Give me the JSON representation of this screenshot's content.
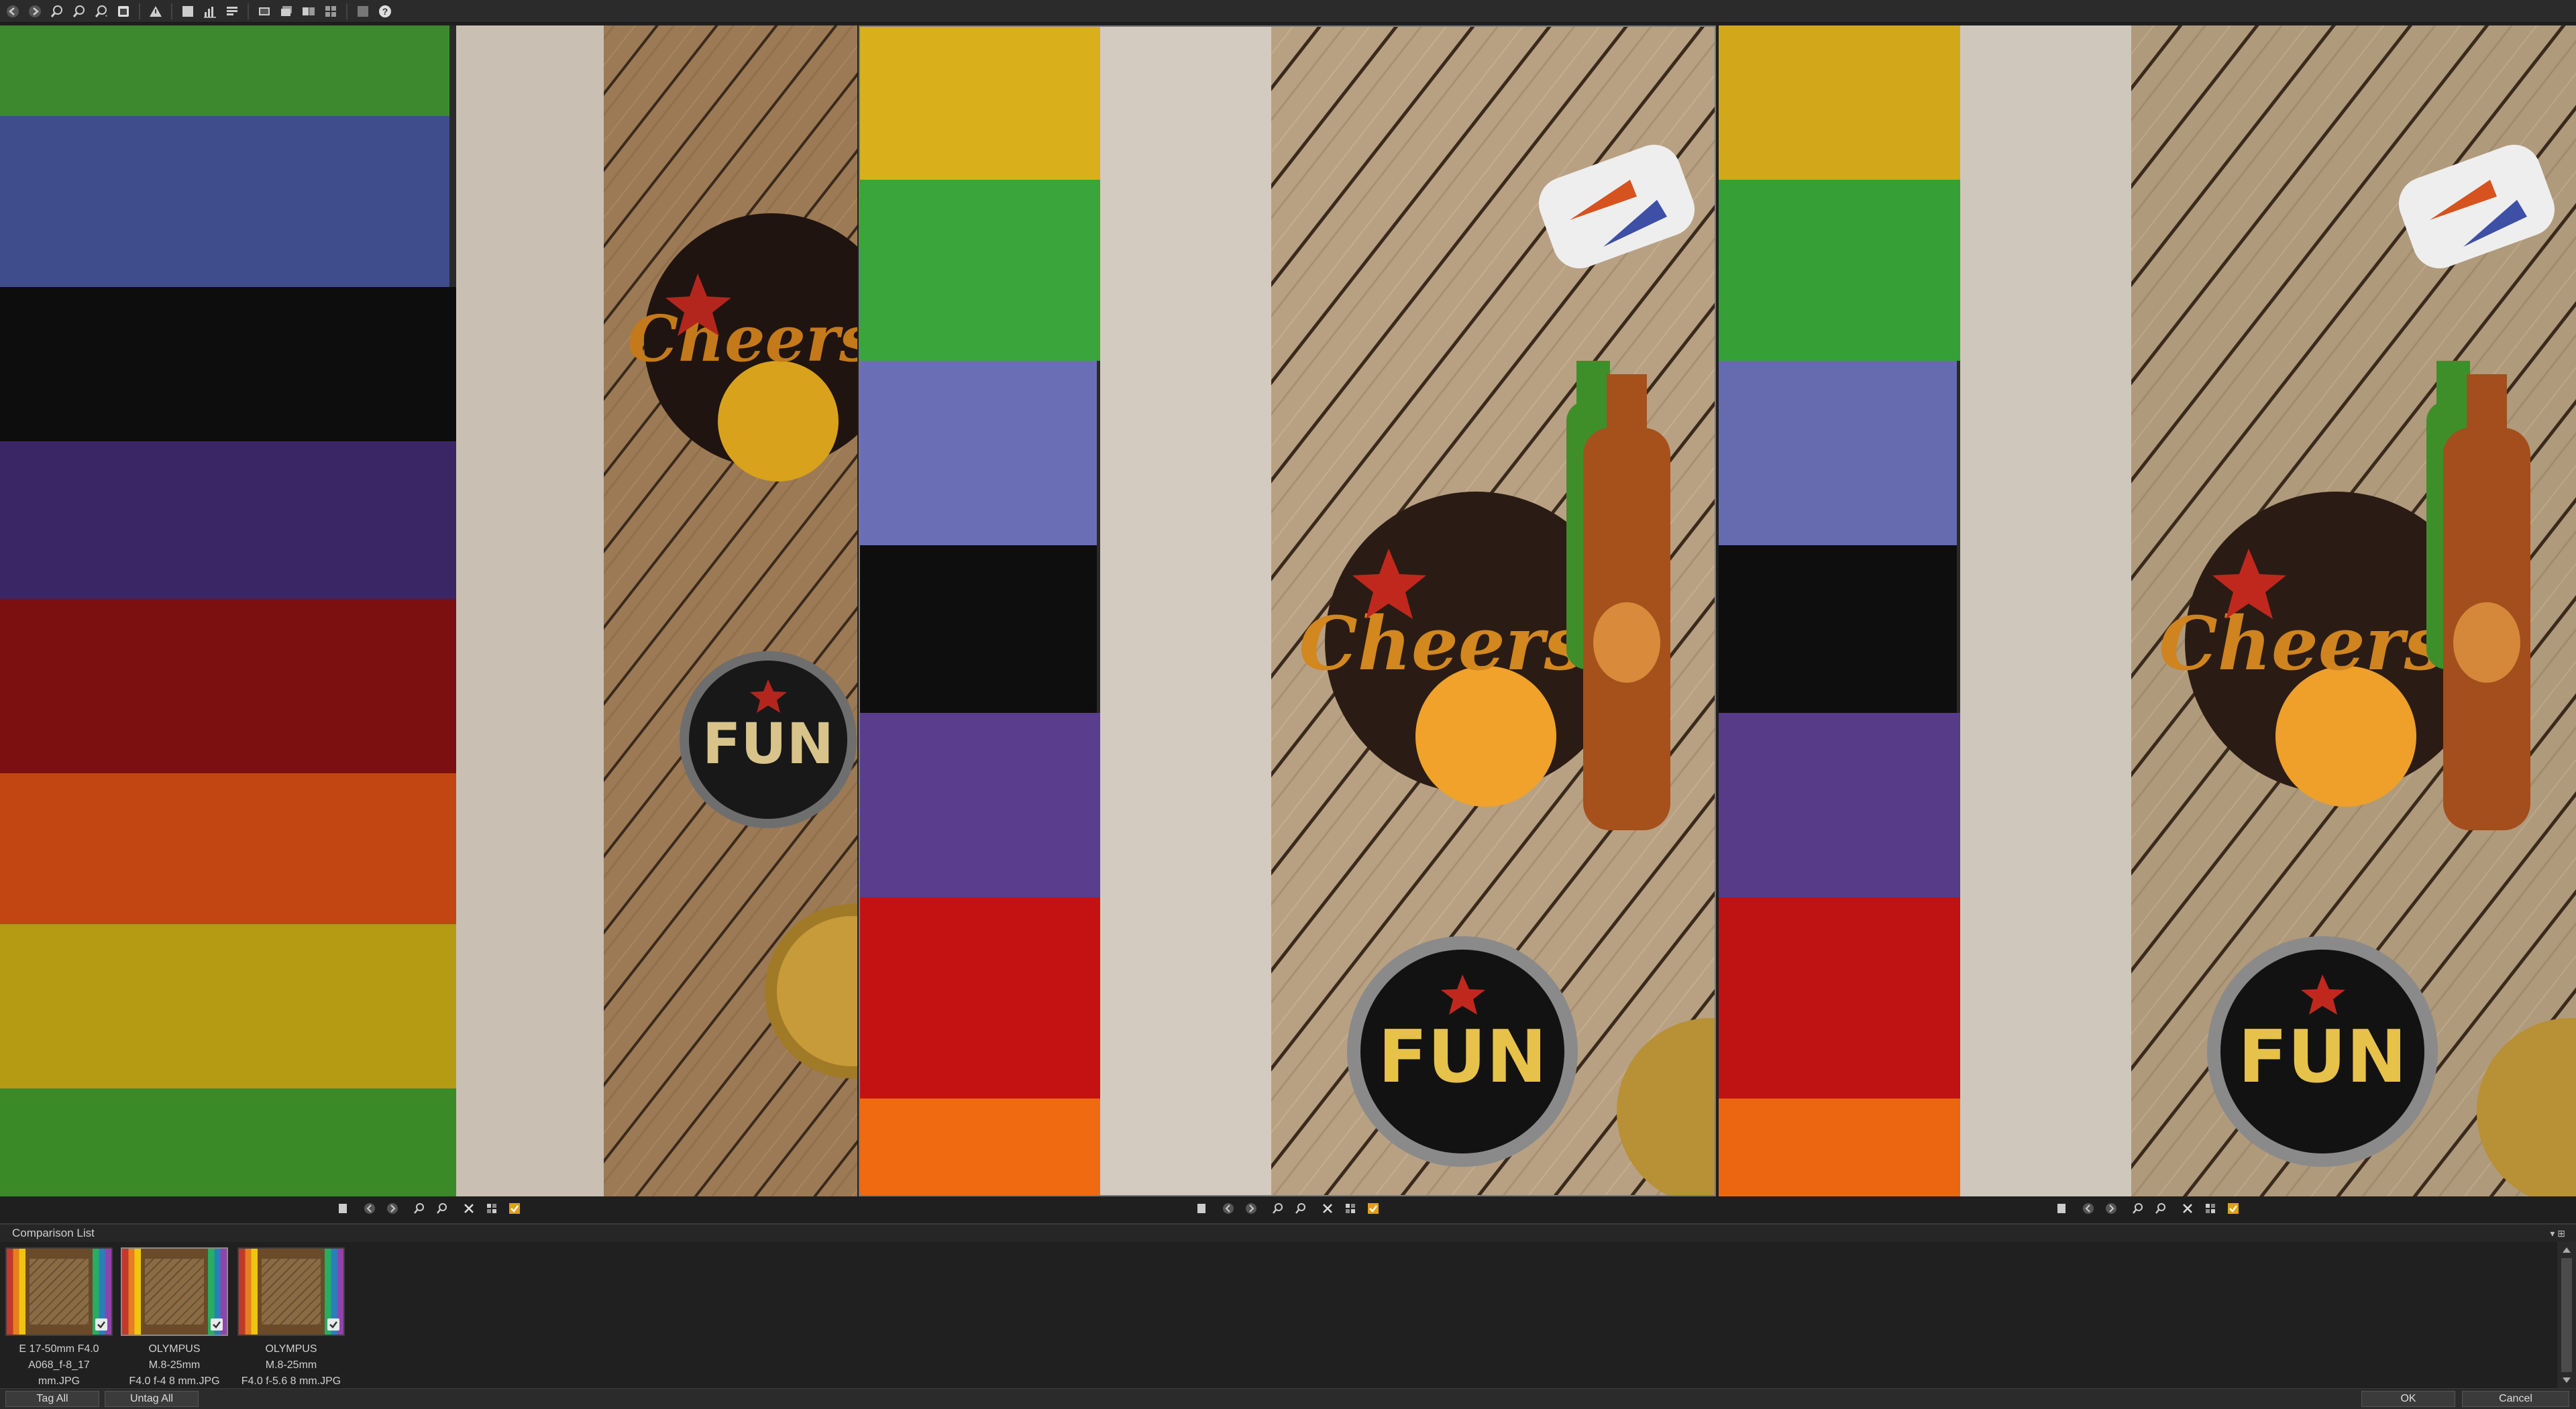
{
  "toolbar": {
    "buttons": [
      "back-icon",
      "forward-icon",
      "zoom-in-icon",
      "zoom-out-icon",
      "zoom-fit-icon",
      "window-icon",
      "warning-icon",
      "square-icon",
      "histogram-icon",
      "layout-icon",
      "photo-icon",
      "photo-stack-icon",
      "photo-compare-icon",
      "photo-grid-icon",
      "tile-icon",
      "help-icon"
    ]
  },
  "panes": [
    {
      "name": "E 17-50mm F4.0 A068_f-8_17 mm.JPG"
    },
    {
      "name": "OLYMPUS M.8-25mm F4.0 f-4 8 mm.JPG"
    },
    {
      "name": "OLYMPUS M.8-25mm F4.0 f-5.6 8 mm.JPG"
    }
  ],
  "pane_tool_icons": [
    "page-icon",
    "prev-icon",
    "next-icon",
    "zoom-in-icon",
    "zoom-out-icon",
    "close-icon",
    "grid-icon",
    "check-icon"
  ],
  "comparison_list": {
    "title": "Comparison List",
    "pin_label": "▾  ⊞",
    "thumbs": [
      {
        "caption": "E 17-50mm F4.0\nA068_f-8_17\nmm.JPG"
      },
      {
        "caption": "OLYMPUS\nM.8-25mm\nF4.0 f-4 8 mm.JPG"
      },
      {
        "caption": "OLYMPUS\nM.8-25mm\nF4.0 f-5.6 8 mm.JPG"
      }
    ]
  },
  "bottom": {
    "tag_all": "Tag All",
    "untag_all": "Untag All",
    "ok": "OK",
    "cancel": "Cancel"
  }
}
